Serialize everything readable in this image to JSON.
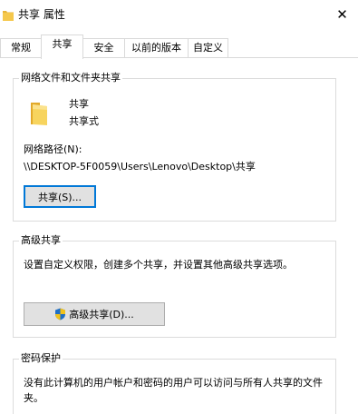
{
  "window": {
    "title": "共享 属性",
    "close_glyph": "✕"
  },
  "tabs": [
    {
      "label": "常规",
      "active": false
    },
    {
      "label": "共享",
      "active": true
    },
    {
      "label": "安全",
      "active": false
    },
    {
      "label": "以前的版本",
      "active": false
    },
    {
      "label": "自定义",
      "active": false
    }
  ],
  "network_sharing": {
    "group_title": "网络文件和文件夹共享",
    "folder_name": "共享",
    "share_status": "共享式",
    "path_label": "网络路径(N):",
    "path_value": "\\\\DESKTOP-5F0059\\Users\\Lenovo\\Desktop\\共享",
    "share_button": "共享(S)..."
  },
  "advanced_sharing": {
    "group_title": "高级共享",
    "description": "设置自定义权限，创建多个共享，并设置其他高级共享选项。",
    "button_label": "高级共享(D)..."
  },
  "password_protection": {
    "group_title": "密码保护",
    "description_line1": "没有此计算机的用户帐户和密码的用户可以访问与所有人共享的文件",
    "description_line2": "夹。"
  },
  "colors": {
    "folder_yellow": "#f5c84c",
    "focus_blue": "#0078d7",
    "shield_blue": "#1f6fc5",
    "shield_yellow": "#f2c21b"
  }
}
